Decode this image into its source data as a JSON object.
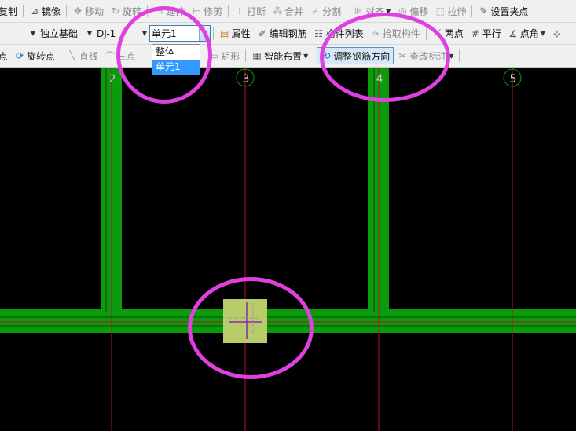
{
  "toolbar1": {
    "copy": "复制",
    "mirror": "镜像",
    "move": "移动",
    "rotate": "旋转",
    "extend": "延伸",
    "trim": "修剪",
    "break": "打断",
    "merge": "合并",
    "split": "分割",
    "align": "对齐",
    "offset": "偏移",
    "stretch": "拉伸",
    "set_grip": "设置夹点"
  },
  "toolbar2": {
    "layer_value": "",
    "component_type": "独立基础",
    "component_name": "DJ-1",
    "unit_value": "单元1",
    "properties": "属性",
    "edit_rebar": "编辑钢筋",
    "component_list": "构件列表",
    "pick_component": "拾取构件",
    "two_points": "两点",
    "parallel": "平行",
    "point_angle": "点角"
  },
  "dropdown": {
    "items": [
      "整体",
      "单元1"
    ],
    "selected_index": 1
  },
  "toolbar3": {
    "point": "点",
    "rotate_point": "旋转点",
    "line": "直线",
    "three_point_arc": "三点",
    "rectangle": "矩形",
    "smart_layout": "智能布置",
    "adjust_rebar_direction": "调整钢筋方向",
    "view_label": "查改标注"
  },
  "grid": {
    "axis_labels": [
      "2",
      "3",
      "4",
      "5"
    ],
    "beam_color": "#0c9b0c",
    "footing_color": "#b8cc6a",
    "axis_line_color": "#b0142a",
    "label_color": "#c8c8c8",
    "circle_color": "#e040e0"
  }
}
